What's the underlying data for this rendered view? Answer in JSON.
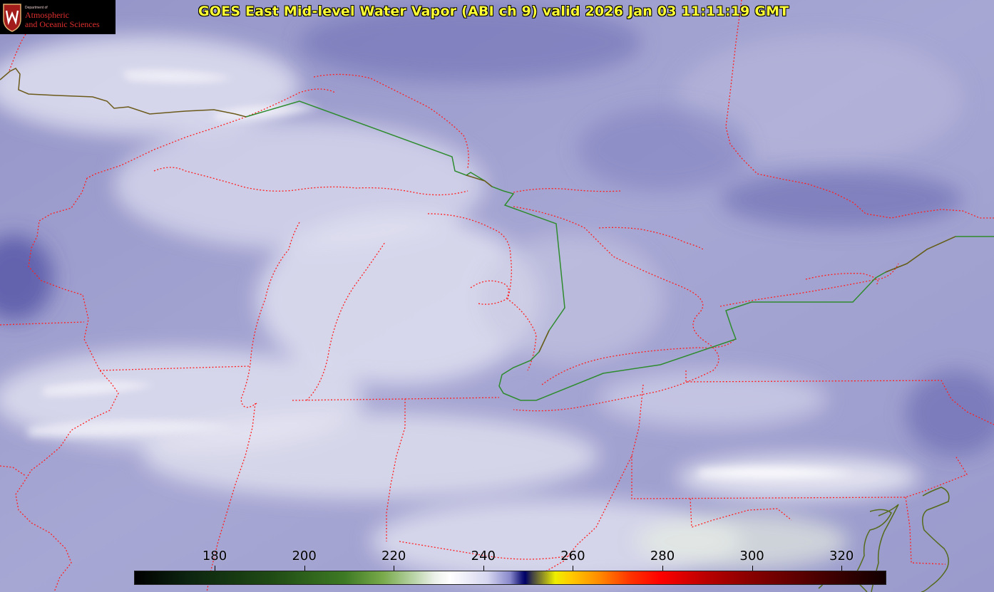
{
  "title": "GOES East Mid-level Water Vapor (ABI ch 9)  valid 2026 Jan 03 11:11:19 GMT",
  "logo": {
    "department": "Department of",
    "line1": "Atmospheric",
    "line2": "and Oceanic Sciences"
  },
  "colorbar": {
    "ticks": [
      "180",
      "200",
      "220",
      "240",
      "260",
      "280",
      "300",
      "320"
    ],
    "tick_values": [
      180,
      200,
      220,
      240,
      260,
      280,
      300,
      320
    ],
    "range": [
      162,
      330
    ]
  },
  "colors": {
    "state_borders": "#ff2020",
    "international_border": "#2e8b2e",
    "coastline": "#556b1a",
    "title_text": "#ffff33"
  }
}
